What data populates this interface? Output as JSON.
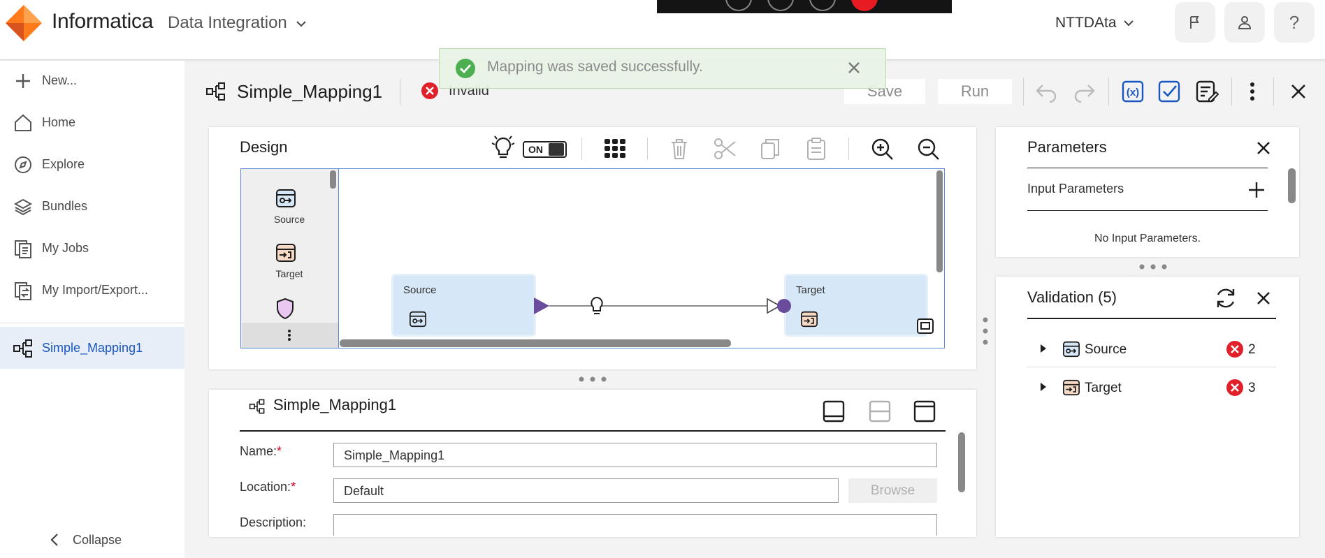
{
  "topbar": {
    "brand": "Informatica",
    "product": "Data Integration",
    "org": "NTTDAta"
  },
  "nav": {
    "new_label": "New...",
    "items": [
      {
        "label": "Home",
        "icon": "home-icon"
      },
      {
        "label": "Explore",
        "icon": "compass-icon"
      },
      {
        "label": "Bundles",
        "icon": "layers-icon"
      },
      {
        "label": "My Jobs",
        "icon": "jobs-icon"
      },
      {
        "label": "My Import/Export...",
        "icon": "import-export-icon"
      }
    ],
    "open_tab": "Simple_Mapping1",
    "collapse_label": "Collapse"
  },
  "toast": {
    "message": "Mapping was saved successfully."
  },
  "header": {
    "title": "Simple_Mapping1",
    "status": "Invalid",
    "save_label": "Save",
    "run_label": "Run"
  },
  "design": {
    "title": "Design",
    "toggle_label": "ON",
    "palette": [
      {
        "label": "Source"
      },
      {
        "label": "Target"
      }
    ],
    "nodes": {
      "source_label": "Source",
      "target_label": "Target"
    }
  },
  "properties": {
    "title": "Simple_Mapping1",
    "name_label": "Name:",
    "name_value": "Simple_Mapping1",
    "location_label": "Location:",
    "location_value": "Default",
    "browse_label": "Browse",
    "description_label": "Description:",
    "required_mark": "*"
  },
  "parameters": {
    "title": "Parameters",
    "input_label": "Input Parameters",
    "empty_text": "No Input Parameters."
  },
  "validation": {
    "title": "Validation (5)",
    "items": [
      {
        "label": "Source",
        "count": "2"
      },
      {
        "label": "Target",
        "count": "3"
      }
    ]
  },
  "colors": {
    "accent": "#1a56c0",
    "error": "#e0202a",
    "success": "#4caf50",
    "node_fill": "#d6e7f7",
    "connector": "#6a4c9c"
  }
}
